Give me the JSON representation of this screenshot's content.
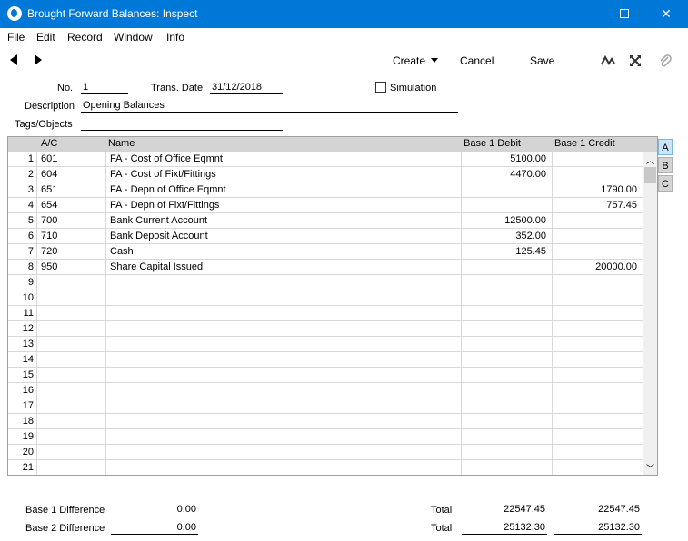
{
  "window": {
    "title": "Brought Forward Balances: Inspect",
    "controls": {
      "minimize": "—",
      "close": "✕"
    }
  },
  "menu": [
    "File",
    "Edit",
    "Record",
    "Window",
    "Info"
  ],
  "toolbar": {
    "create_label": "Create",
    "cancel_label": "Cancel",
    "save_label": "Save"
  },
  "header": {
    "no_label": "No.",
    "no_value": "1",
    "trans_date_label": "Trans. Date",
    "trans_date_value": "31/12/2018",
    "simulation_label": "Simulation",
    "simulation_checked": false,
    "description_label": "Description",
    "description_value": "Opening Balances",
    "tags_label": "Tags/Objects",
    "tags_value": ""
  },
  "grid": {
    "columns": [
      "A/C",
      "Name",
      "Base 1 Debit",
      "Base 1 Credit"
    ],
    "rows": [
      {
        "n": "1",
        "ac": "601",
        "name": "FA - Cost of Office Eqmnt",
        "debit": "5100.00",
        "credit": ""
      },
      {
        "n": "2",
        "ac": "604",
        "name": "FA - Cost of Fixt/Fittings",
        "debit": "4470.00",
        "credit": ""
      },
      {
        "n": "3",
        "ac": "651",
        "name": "FA - Depn of Office Eqmnt",
        "debit": "",
        "credit": "1790.00"
      },
      {
        "n": "4",
        "ac": "654",
        "name": "FA - Depn of Fixt/Fittings",
        "debit": "",
        "credit": "757.45"
      },
      {
        "n": "5",
        "ac": "700",
        "name": "Bank Current Account",
        "debit": "12500.00",
        "credit": ""
      },
      {
        "n": "6",
        "ac": "710",
        "name": "Bank Deposit Account",
        "debit": "352.00",
        "credit": ""
      },
      {
        "n": "7",
        "ac": "720",
        "name": "Cash",
        "debit": "125.45",
        "credit": ""
      },
      {
        "n": "8",
        "ac": "950",
        "name": "Share Capital Issued",
        "debit": "",
        "credit": "20000.00"
      },
      {
        "n": "9",
        "ac": "",
        "name": "",
        "debit": "",
        "credit": ""
      },
      {
        "n": "10",
        "ac": "",
        "name": "",
        "debit": "",
        "credit": ""
      },
      {
        "n": "11",
        "ac": "",
        "name": "",
        "debit": "",
        "credit": ""
      },
      {
        "n": "12",
        "ac": "",
        "name": "",
        "debit": "",
        "credit": ""
      },
      {
        "n": "13",
        "ac": "",
        "name": "",
        "debit": "",
        "credit": ""
      },
      {
        "n": "14",
        "ac": "",
        "name": "",
        "debit": "",
        "credit": ""
      },
      {
        "n": "15",
        "ac": "",
        "name": "",
        "debit": "",
        "credit": ""
      },
      {
        "n": "16",
        "ac": "",
        "name": "",
        "debit": "",
        "credit": ""
      },
      {
        "n": "17",
        "ac": "",
        "name": "",
        "debit": "",
        "credit": ""
      },
      {
        "n": "18",
        "ac": "",
        "name": "",
        "debit": "",
        "credit": ""
      },
      {
        "n": "19",
        "ac": "",
        "name": "",
        "debit": "",
        "credit": ""
      },
      {
        "n": "20",
        "ac": "",
        "name": "",
        "debit": "",
        "credit": ""
      },
      {
        "n": "21",
        "ac": "",
        "name": "",
        "debit": "",
        "credit": ""
      }
    ]
  },
  "side_tabs": [
    "A",
    "B",
    "C"
  ],
  "active_tab": "A",
  "footer": {
    "base1_diff_label": "Base 1 Difference",
    "base1_diff_value": "0.00",
    "base2_diff_label": "Base 2 Difference",
    "base2_diff_value": "0.00",
    "total_label": "Total",
    "total1_debit": "22547.45",
    "total1_credit": "22547.45",
    "total2_debit": "25132.30",
    "total2_credit": "25132.30"
  },
  "colors": {
    "titlebar": "#0078d7",
    "grid_header": "#d4d4d4",
    "active_tab": "#cce4f7"
  },
  "icons": [
    "app-icon",
    "nav-back-icon",
    "nav-forward-icon",
    "chart-icon",
    "expand-icon",
    "paperclip-icon"
  ]
}
